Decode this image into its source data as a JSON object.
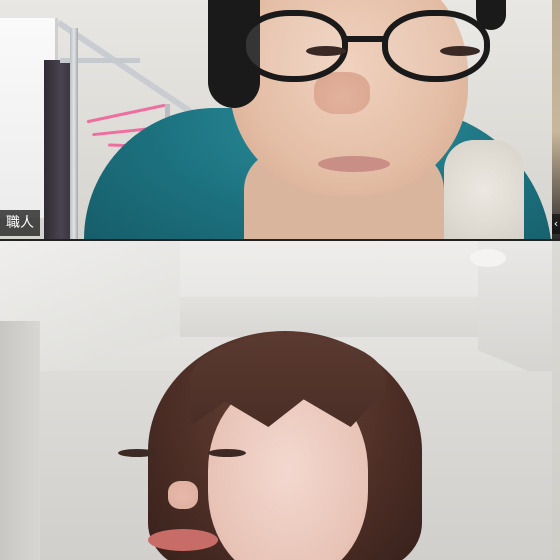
{
  "app": {
    "window_title": ""
  },
  "participants": [
    {
      "position": "top",
      "name_label": "職人"
    },
    {
      "position": "bottom",
      "name_label": ""
    }
  ],
  "side_strip": {
    "arrow_icon": "chevron-left-icon",
    "arrow_glyph": "‹"
  },
  "colors": {
    "name_label_bg": "#1e1e1e",
    "name_label_text": "#ffffff",
    "divider": "#222222"
  }
}
